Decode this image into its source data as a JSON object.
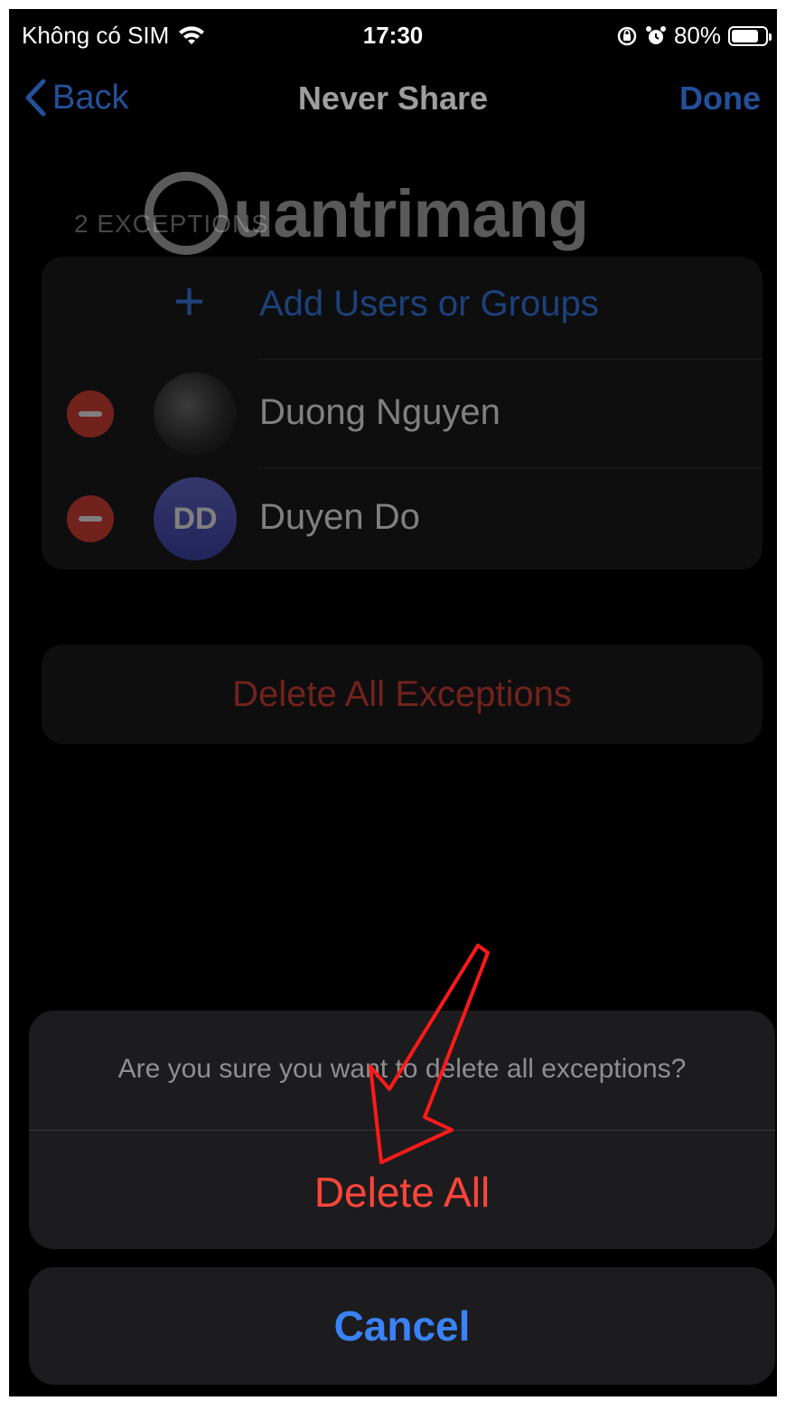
{
  "status_bar": {
    "carrier": "Không có SIM",
    "time": "17:30",
    "battery": "80%",
    "battery_level": 0.8
  },
  "nav": {
    "back_label": "Back",
    "title": "Never Share",
    "done_label": "Done"
  },
  "exceptions": {
    "section_header": "2 EXCEPTIONS",
    "add_label": "Add Users or Groups",
    "contacts": [
      {
        "name": "Duong Nguyen",
        "initials": ""
      },
      {
        "name": "Duyen Do",
        "initials": "DD"
      }
    ],
    "delete_all_label": "Delete All Exceptions"
  },
  "watermark": {
    "text": "uantrimang"
  },
  "action_sheet": {
    "message": "Are you sure you want to delete all exceptions?",
    "destructive_label": "Delete All",
    "cancel_label": "Cancel"
  },
  "colors": {
    "accent": "#3a82f7",
    "destructive": "#ff453a",
    "annotation": "#ff1a1a"
  }
}
